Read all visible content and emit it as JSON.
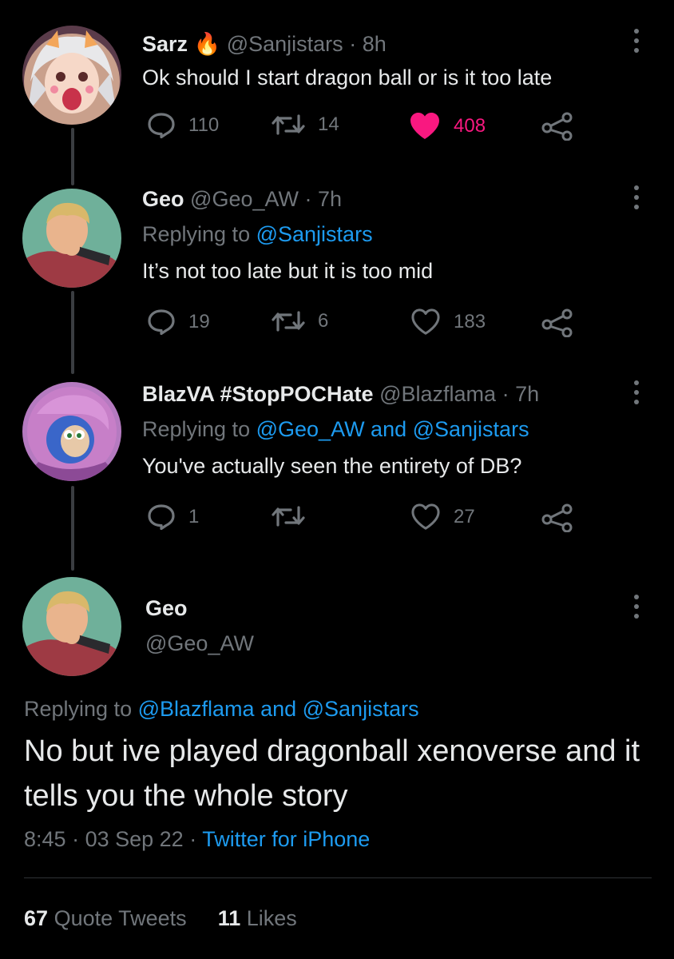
{
  "tweets": [
    {
      "name": "Sarz",
      "emoji": "🔥",
      "handle": "@Sanjistars",
      "sep": "·",
      "time": "8h",
      "text": "Ok should I start dragon ball or is it too late",
      "replies": "110",
      "retweets": "14",
      "likes": "408",
      "liked": true
    },
    {
      "name": "Geo",
      "handle": "@Geo_AW",
      "sep": "·",
      "time": "7h",
      "replying_prefix": "Replying to",
      "replying_to": "@Sanjistars",
      "text": "It’s not too late but it is too mid",
      "replies": "19",
      "retweets": "6",
      "likes": "183"
    },
    {
      "name": "BlazVA #StopPOCHate",
      "handle": "@Blazflama",
      "sep": "·",
      "time": "7h",
      "replying_prefix": "Replying to",
      "replying_to": "@Geo_AW and @Sanjistars",
      "text": "You've actually seen the entirety of DB?",
      "replies": "1",
      "retweets": "",
      "likes": "27"
    }
  ],
  "main": {
    "name": "Geo",
    "handle": "@Geo_AW",
    "replying_prefix": "Replying to",
    "replying_to": "@Blazflama and @Sanjistars",
    "text": "No but ive played dragonball xenoverse and it tells you the whole story",
    "time": "8:45",
    "sep1": "·",
    "date": "03 Sep 22",
    "sep2": "·",
    "source": "Twitter for iPhone",
    "quote_count": "67",
    "quote_label": "Quote Tweets",
    "like_count": "11",
    "like_label": "Likes"
  },
  "colors": {
    "background": "#000000",
    "text": "#e7e9ea",
    "secondary": "#71767b",
    "link": "#1d9bf0",
    "like": "#f91880"
  }
}
